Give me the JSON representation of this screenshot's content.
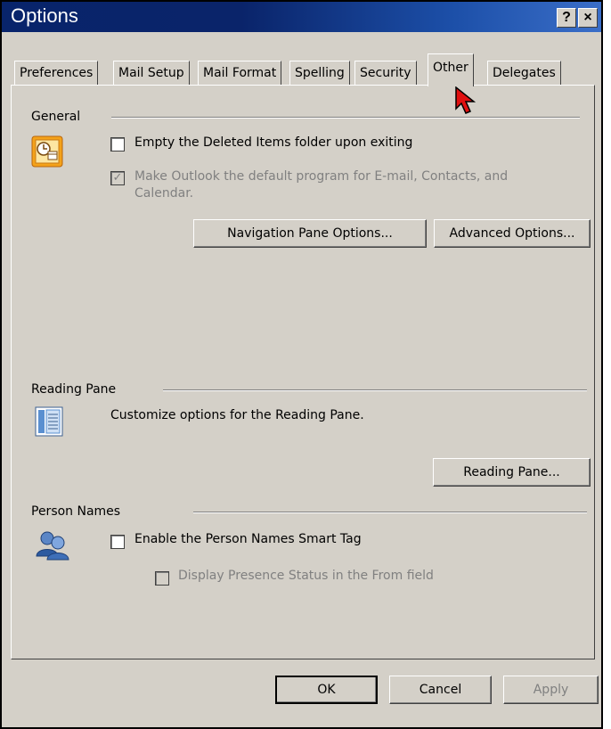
{
  "window": {
    "title": "Options",
    "help_label": "?",
    "close_label": "×"
  },
  "tabs": [
    {
      "label": "Preferences"
    },
    {
      "label": "Mail Setup"
    },
    {
      "label": "Mail Format"
    },
    {
      "label": "Spelling"
    },
    {
      "label": "Security"
    },
    {
      "label": "Other",
      "active": true
    },
    {
      "label": "Delegates"
    }
  ],
  "general": {
    "title": "General",
    "empty_deleted_label": "Empty the Deleted Items folder upon exiting",
    "empty_deleted_checked": false,
    "default_program_label": "Make Outlook the default program for E-mail, Contacts, and Calendar.",
    "default_program_checked": true,
    "navigation_pane_button": "Navigation Pane Options...",
    "advanced_options_button": "Advanced Options..."
  },
  "reading_pane": {
    "title": "Reading Pane",
    "description": "Customize options for the Reading Pane.",
    "button": "Reading Pane..."
  },
  "person_names": {
    "title": "Person Names",
    "smart_tag_label": "Enable the Person Names Smart Tag",
    "smart_tag_checked": false,
    "presence_label": "Display Presence Status in the From field",
    "presence_checked": false
  },
  "footer": {
    "ok": "OK",
    "cancel": "Cancel",
    "apply": "Apply"
  },
  "check_mark": "✓"
}
